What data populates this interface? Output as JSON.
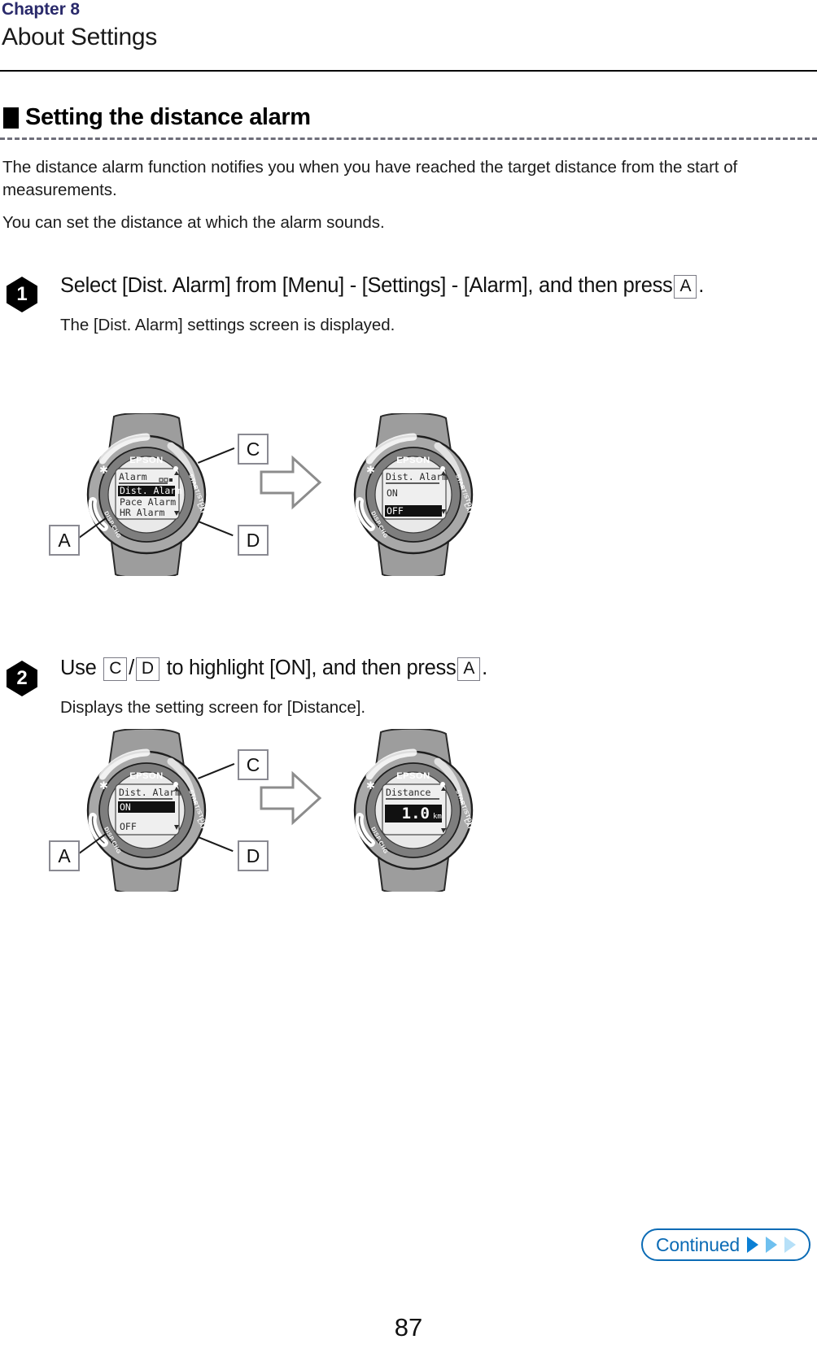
{
  "header": {
    "chapter": "Chapter 8",
    "title": "About Settings"
  },
  "section": {
    "heading": "Setting the distance alarm",
    "intro_line1": "The distance alarm function notifies you when you have reached the target distance from the start of measurements.",
    "intro_line2": "You can set the distance at which the alarm sounds."
  },
  "steps": [
    {
      "number": "1",
      "title_part1": "Select [Dist. Alarm] from [Menu] - [Settings] - [Alarm], and then press",
      "key": "A",
      "title_part2": ".",
      "note": "The [Dist. Alarm] settings screen is displayed."
    },
    {
      "number": "2",
      "title_part1": "Use",
      "key1": "C",
      "slash": "/",
      "key2": "D",
      "title_part2": "to highlight [ON], and then press",
      "key3": "A",
      "title_part3": ".",
      "note": "Displays the setting screen for [Distance]."
    }
  ],
  "figures": [
    {
      "callouts": {
        "top_right": "C",
        "bottom_right": "D",
        "bottom_left": "A"
      },
      "watch_left": {
        "brand": "EPSON",
        "bezel_left": "DISP.CHG",
        "bezel_right_top": "START/STOP",
        "bezel_right_bottom": "LAP/RESET",
        "screen_title": "Alarm",
        "rows": [
          {
            "label": "Dist. Alarm",
            "highlighted": true
          },
          {
            "label": "Pace Alarm",
            "highlighted": false
          },
          {
            "label": "HR Alarm",
            "highlighted": false
          }
        ],
        "has_page_dots": true
      },
      "watch_right": {
        "brand": "EPSON",
        "bezel_left": "DISP.CHG",
        "bezel_right_top": "START/STOP",
        "bezel_right_bottom": "LAP/RESET",
        "screen_title": "Dist. Alarm",
        "rows": [
          {
            "label": "ON",
            "highlighted": false
          },
          {
            "label": "OFF",
            "highlighted": true
          }
        ],
        "has_page_dots": false
      }
    },
    {
      "callouts": {
        "top_right": "C",
        "bottom_right": "D",
        "bottom_left": "A"
      },
      "watch_left": {
        "brand": "EPSON",
        "bezel_left": "DISP.CHG",
        "bezel_right_top": "START/STOP",
        "bezel_right_bottom": "LAP/RESET",
        "screen_title": "Dist. Alarm",
        "rows": [
          {
            "label": "ON",
            "highlighted": true
          },
          {
            "label": "OFF",
            "highlighted": false
          }
        ],
        "has_page_dots": false
      },
      "watch_right": {
        "brand": "EPSON",
        "bezel_left": "DISP.CHG",
        "bezel_right_top": "START/STOP",
        "bezel_right_bottom": "LAP/RESET",
        "screen_title": "Distance",
        "value": "1.0",
        "unit": "km",
        "rows": [],
        "has_page_dots": false
      }
    }
  ],
  "footer": {
    "continued_label": "Continued",
    "page_number": "87"
  },
  "colors": {
    "chapter_accent": "#2a2a6b",
    "continued_blue": "#0b6bb5",
    "arrow_blue": "#0b7fd4"
  }
}
